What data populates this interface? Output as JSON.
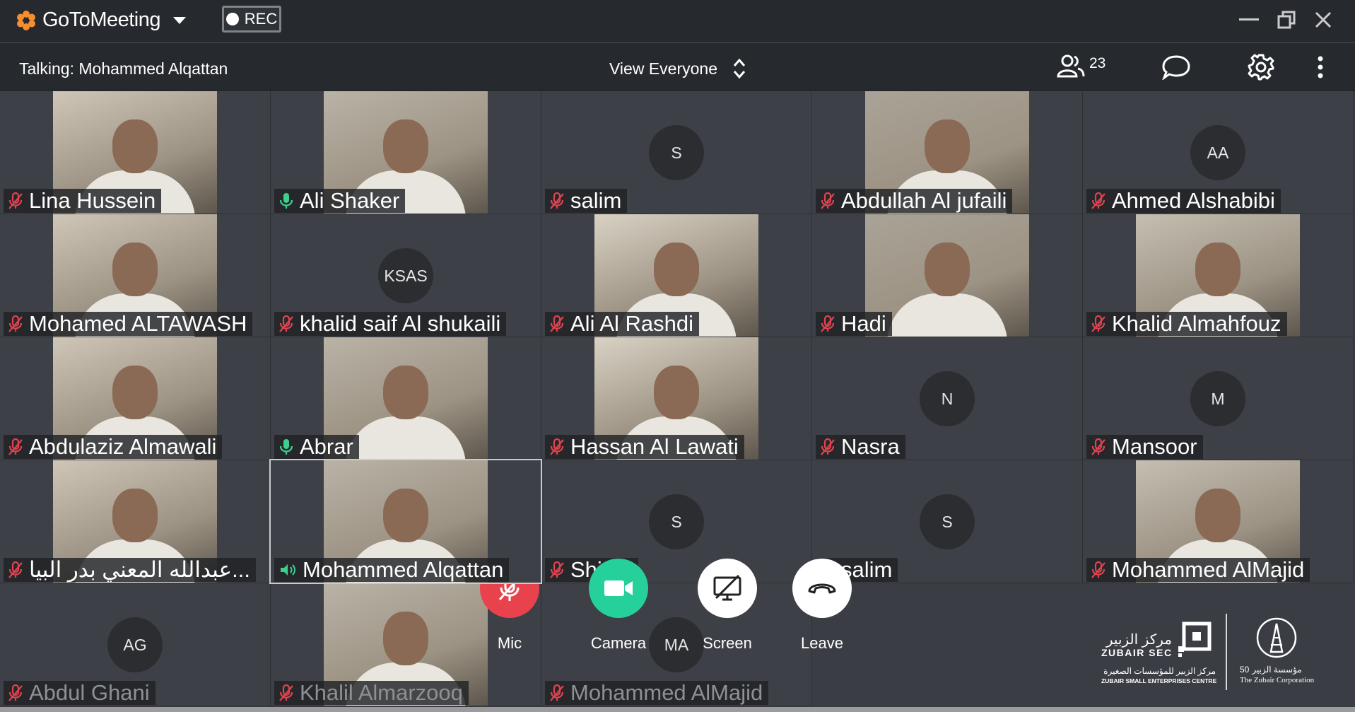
{
  "app": {
    "brand_name": "GoToMeeting",
    "rec_label": "REC"
  },
  "subbar": {
    "talking": "Talking: Mohammed Alqattan",
    "view_mode": "View Everyone",
    "participant_count": "23"
  },
  "tiles": [
    {
      "name": "Lina Hussein",
      "mic": "muted",
      "type": "video"
    },
    {
      "name": "Ali Shaker",
      "mic": "on",
      "type": "video"
    },
    {
      "name": "salim",
      "mic": "muted",
      "type": "avatar",
      "initials": "S"
    },
    {
      "name": "Abdullah Al jufaili",
      "mic": "muted",
      "type": "video"
    },
    {
      "name": "Ahmed Alshabibi",
      "mic": "muted",
      "type": "avatar",
      "initials": "AA"
    },
    {
      "name": "Mohamed ALTAWASH",
      "mic": "muted",
      "type": "video"
    },
    {
      "name": "khalid  saif Al shukaili",
      "mic": "muted",
      "type": "avatar",
      "initials": "KSAS"
    },
    {
      "name": "Ali Al Rashdi",
      "mic": "muted",
      "type": "video"
    },
    {
      "name": "Hadi",
      "mic": "muted",
      "type": "video"
    },
    {
      "name": "Khalid Almahfouz",
      "mic": "muted",
      "type": "video"
    },
    {
      "name": "Abdulaziz Almawali",
      "mic": "muted",
      "type": "video"
    },
    {
      "name": "Abrar",
      "mic": "on",
      "type": "video"
    },
    {
      "name": "Hassan Al Lawati",
      "mic": "muted",
      "type": "video"
    },
    {
      "name": "Nasra",
      "mic": "muted",
      "type": "avatar",
      "initials": "N"
    },
    {
      "name": "Mansoor",
      "mic": "muted",
      "type": "avatar",
      "initials": "M"
    },
    {
      "name": "عبدالله المعني بدر البيا...",
      "mic": "muted",
      "type": "video"
    },
    {
      "name": "Mohammed Alqattan",
      "mic": "talking",
      "type": "video",
      "active": true
    },
    {
      "name": "Shima",
      "mic": "muted",
      "type": "avatar",
      "initials": "S"
    },
    {
      "name": "salim",
      "mic": "muted",
      "type": "avatar",
      "initials": "S"
    },
    {
      "name": "Mohammed AlMajid",
      "mic": "muted",
      "type": "video"
    },
    {
      "name": "Abdul Ghani",
      "mic": "muted",
      "type": "avatar",
      "initials": "AG",
      "dim": true
    },
    {
      "name": "Khalil Almarzooq",
      "mic": "muted",
      "type": "video",
      "dim": true
    },
    {
      "name": "Mohammed AlMajid",
      "mic": "muted",
      "type": "avatar",
      "initials": "MA",
      "dim": true
    }
  ],
  "controls": {
    "mic": "Mic",
    "camera": "Camera",
    "screen": "Screen",
    "leave": "Leave"
  },
  "logos": {
    "zubair_sec_ar": "مركز الزبير",
    "zubair_sec_en": "ZUBAIR SEC",
    "zubair_sec_sub_ar": "مركز الزبير للمؤسسات الصغيرة",
    "zubair_sec_sub_en": "ZUBAIR SMALL ENTERPRISES CENTRE",
    "corp_ar": "مؤسسة الزبير",
    "corp_en": "The Zubair Corporation",
    "corp_years": "50"
  },
  "colors": {
    "mic_red": "#e8434d",
    "camera_green": "#25d09a",
    "talking_green": "#3ecf8e",
    "muted_red": "#e0434f"
  }
}
